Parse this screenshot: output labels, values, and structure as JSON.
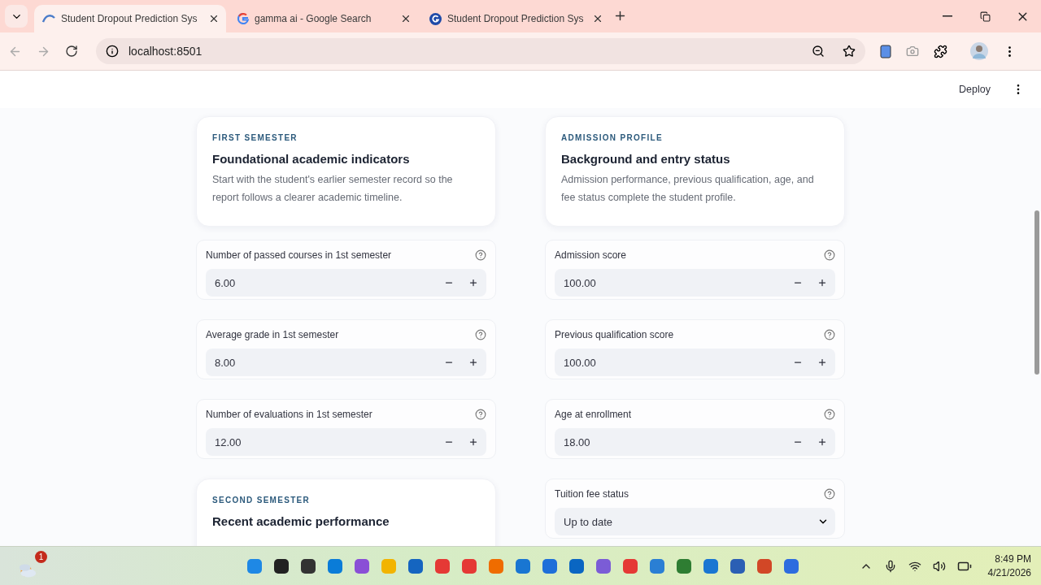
{
  "browser": {
    "tabs": [
      {
        "title": "Student Dropout Prediction Sys",
        "selected": true
      },
      {
        "title": "gamma ai - Google Search",
        "selected": false
      },
      {
        "title": "Student Dropout Prediction Sys",
        "selected": false
      }
    ],
    "address": "localhost:8501"
  },
  "app_header": {
    "deploy": "Deploy"
  },
  "columns": [
    {
      "items": [
        {
          "kind": "card",
          "eyebrow": "FIRST SEMESTER",
          "title": "Foundational academic indicators",
          "description": "Start with the student's earlier semester record so the report follows a clearer academic timeline."
        },
        {
          "kind": "number",
          "label": "Number of passed courses in 1st semester",
          "value": "6.00"
        },
        {
          "kind": "number",
          "label": "Average grade in 1st semester",
          "value": "8.00"
        },
        {
          "kind": "number",
          "label": "Number of evaluations in 1st semester",
          "value": "12.00"
        },
        {
          "kind": "card",
          "eyebrow": "SECOND SEMESTER",
          "title": "Recent academic performance"
        }
      ]
    },
    {
      "items": [
        {
          "kind": "card",
          "eyebrow": "ADMISSION PROFILE",
          "title": "Background and entry status",
          "description": "Admission performance, previous qualification, age, and fee status complete the student profile."
        },
        {
          "kind": "number",
          "label": "Admission score",
          "value": "100.00"
        },
        {
          "kind": "number",
          "label": "Previous qualification score",
          "value": "100.00"
        },
        {
          "kind": "number",
          "label": "Age at enrollment",
          "value": "18.00"
        },
        {
          "kind": "select",
          "label": "Tuition fee status",
          "value": "Up to date"
        }
      ]
    }
  ],
  "taskbar": {
    "notification_count": "1",
    "time": "8:49 PM",
    "date": "4/21/2026"
  }
}
